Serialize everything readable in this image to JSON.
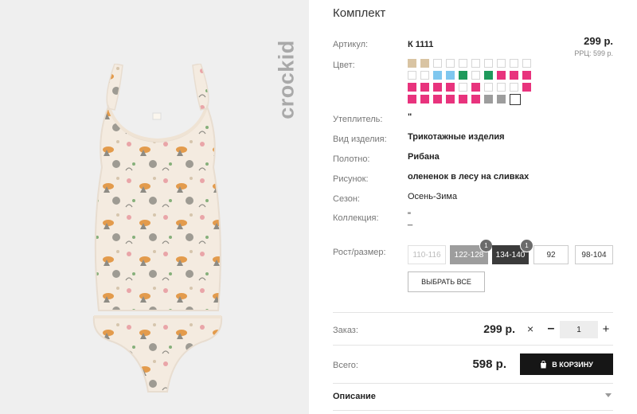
{
  "brand": {
    "logo_text": "crockid"
  },
  "product": {
    "title": "Комплект",
    "article_label": "Артикул:",
    "article_value": "К 1111",
    "price": "299 р.",
    "rrp": "РРЦ: 599 р.",
    "color_label": "Цвет:",
    "colors": [
      "#d9c4a3",
      "#d9c4a3",
      "empty",
      "empty",
      "empty",
      "empty",
      "empty",
      "empty",
      "empty",
      "empty",
      "empty",
      "empty",
      "#7fc7ef",
      "#7fc7ef",
      "#1f9a5c",
      "empty",
      "#1f9a5c",
      "#e8337d",
      "#e8337d",
      "#e8337d",
      "#e8337d",
      "#e8337d",
      "#e8337d",
      "#e8337d",
      "empty",
      "#e8337d",
      "empty",
      "empty",
      "empty",
      "#e8337d",
      "#e8337d",
      "#e8337d",
      "#e8337d",
      "#e8337d",
      "#e8337d",
      "#e8337d",
      "#9d9d9d",
      "#9d9d9d",
      "selected"
    ],
    "specs": [
      {
        "label": "Утеплитель:",
        "value": "\"",
        "bold": true
      },
      {
        "label": "Вид изделия:",
        "value": "Трикотажные изделия",
        "bold": true
      },
      {
        "label": "Полотно:",
        "value": "Рибана",
        "bold": true
      },
      {
        "label": "Рисунок:",
        "value": "олененок в лесу на сливках",
        "bold": true
      },
      {
        "label": "Сезон:",
        "value": "Осень-Зима",
        "bold": false
      },
      {
        "label": "Коллекция:",
        "value": "\"\n_",
        "bold": false
      }
    ],
    "size_label": "Рост/размер:",
    "sizes": [
      {
        "label": "110-116",
        "state": "disabled",
        "badge": ""
      },
      {
        "label": "122-128",
        "state": "grey",
        "badge": "1"
      },
      {
        "label": "134-140",
        "state": "dark",
        "badge": "1"
      },
      {
        "label": "92",
        "state": "normal",
        "badge": ""
      },
      {
        "label": "98-104",
        "state": "normal",
        "badge": ""
      }
    ],
    "select_all": "ВЫБРАТЬ ВСЕ"
  },
  "order": {
    "label": "Заказ:",
    "price": "299 р.",
    "times": "×",
    "minus": "–",
    "quantity": "1",
    "plus": "+"
  },
  "total": {
    "label": "Всего:",
    "value": "598 р.",
    "cart_button": "В КОРЗИНУ"
  },
  "description": {
    "label": "Описание"
  }
}
